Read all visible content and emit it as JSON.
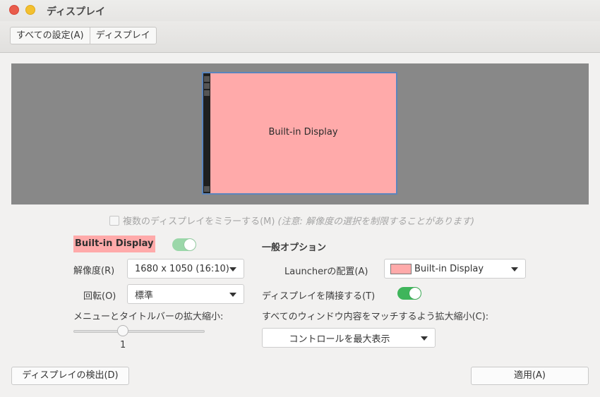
{
  "window": {
    "title": "ディスプレイ"
  },
  "breadcrumbs": [
    "すべての設定(A)",
    "ディスプレイ"
  ],
  "preview": {
    "monitor_label": "Built-in Display"
  },
  "mirror": {
    "label": "複数のディスプレイをミラーする(M)",
    "note": "(注意: 解像度の選択を制限することがあります)",
    "checked": false
  },
  "display": {
    "name": "Built-in Display",
    "enabled": true,
    "resolution_label": "解像度(R)",
    "resolution_value": "1680 x 1050 (16:10)",
    "rotation_label": "回転(O)",
    "rotation_value": "標準",
    "scale_label": "メニューとタイトルバーの拡大縮小:",
    "scale_value": "1"
  },
  "general": {
    "heading": "一般オプション",
    "launcher_label": "Launcherの配置(A)",
    "launcher_value": "Built-in Display",
    "sticky_label": "ディスプレイを隣接する(T)",
    "sticky_enabled": true,
    "scale_all_label": "すべてのウィンドウ内容をマッチするよう拡大縮小(C):",
    "scale_all_value": "コントロールを最大表示"
  },
  "buttons": {
    "detect": "ディスプレイの検出(D)",
    "apply": "適用(A)"
  },
  "colors": {
    "display_color": "#ffaaaa",
    "switch_on": "#3fb55b",
    "preview_bg": "#888888"
  }
}
